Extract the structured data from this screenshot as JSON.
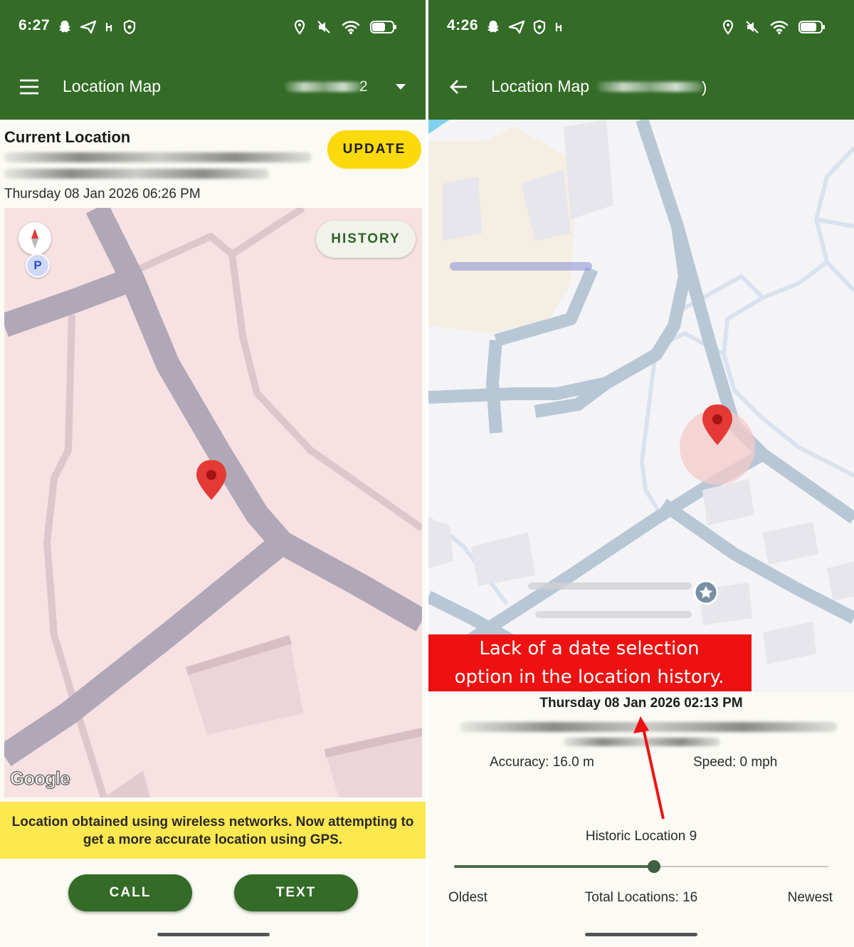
{
  "left": {
    "status": {
      "time": "6:27"
    },
    "appbar": {
      "title": "Location Map",
      "device_suffix": "2"
    },
    "current": {
      "heading": "Current Location",
      "timestamp": "Thursday 08 Jan 2026 06:26 PM"
    },
    "buttons": {
      "update": "UPDATE",
      "history": "HISTORY",
      "call": "CALL",
      "text": "TEXT"
    },
    "map": {
      "parking_badge": "P",
      "logo": "Google"
    },
    "banner": "Location obtained using wireless networks. Now attempting to get a more accurate location using GPS."
  },
  "right": {
    "status": {
      "time": "4:26"
    },
    "appbar": {
      "title": "Location Map",
      "title_suffix": ")"
    },
    "annotation": "Lack of a date selection option in the location history.",
    "history": {
      "timestamp": "Thursday 08 Jan 2026 02:13 PM",
      "accuracy": "Accuracy: 16.0 m",
      "speed": "Speed: 0 mph",
      "current_label": "Historic Location 9",
      "oldest_label": "Oldest",
      "total_label": "Total Locations: 16",
      "newest_label": "Newest",
      "slider_value": 9,
      "slider_max": 16
    }
  },
  "colors": {
    "primary": "#336b27",
    "accent": "#fada0b",
    "banner": "#fde84f",
    "annotation": "#ee1111",
    "pin": "#e53935"
  }
}
